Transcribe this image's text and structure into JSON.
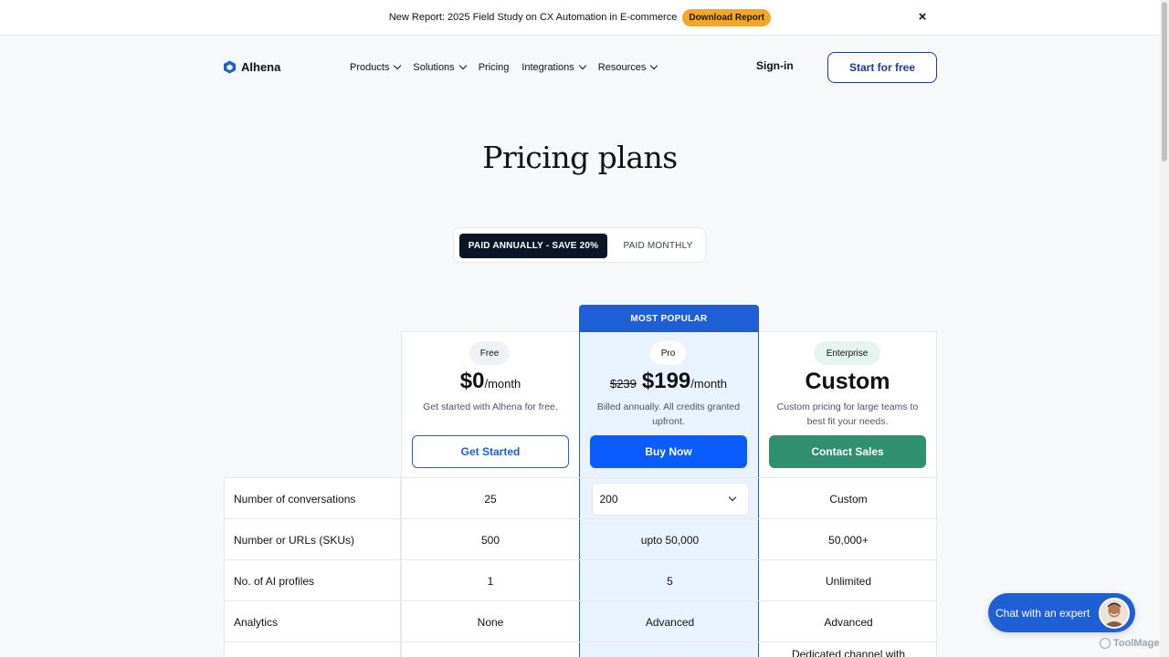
{
  "announcement": {
    "text": "New Report: 2025 Field Study on CX Automation in E-commerce",
    "button_label": "Download Report",
    "close_symbol": "×"
  },
  "header": {
    "brand": "Alhena",
    "nav": [
      {
        "label": "Products",
        "has_dropdown": true
      },
      {
        "label": "Solutions",
        "has_dropdown": true
      },
      {
        "label": "Pricing",
        "has_dropdown": false
      },
      {
        "label": "Integrations",
        "has_dropdown": true
      },
      {
        "label": "Resources",
        "has_dropdown": true
      }
    ],
    "signin_label": "Sign-in",
    "start_label": "Start for free"
  },
  "page": {
    "title": "Pricing plans"
  },
  "billing_toggle": {
    "annual_label": "PAID ANNUALLY - SAVE 20%",
    "monthly_label": "PAID MONTHLY",
    "selected": "annual"
  },
  "plans": {
    "most_popular_label": "MOST POPULAR",
    "free": {
      "badge": "Free",
      "price": "$0",
      "period": "/month",
      "description": "Get started with Alhena for free.",
      "cta": "Get Started"
    },
    "pro": {
      "badge": "Pro",
      "old_price": "$239",
      "price": "$199",
      "period": "/month",
      "description": "Billed annually. All credits granted upfront.",
      "cta": "Buy Now"
    },
    "enterprise": {
      "badge": "Enterprise",
      "price": "Custom",
      "description": "Custom pricing for large teams to best fit your needs.",
      "cta": "Contact Sales"
    }
  },
  "features": [
    {
      "label": "Number of conversations",
      "free": "25",
      "pro": "200",
      "enterprise": "Custom"
    },
    {
      "label": "Number or URLs (SKUs)",
      "free": "500",
      "pro": "upto 50,000",
      "enterprise": "50,000+"
    },
    {
      "label": "No. of AI profiles",
      "free": "1",
      "pro": "5",
      "enterprise": "Unlimited"
    },
    {
      "label": "Analytics",
      "free": "None",
      "pro": "Advanced",
      "enterprise": "Advanced"
    },
    {
      "label": "",
      "free": "",
      "pro": "",
      "enterprise": "Dedicated channel with"
    }
  ],
  "chat_widget": {
    "label": "Chat with an expert"
  },
  "watermark": "ToolMage",
  "colors": {
    "brand_blue": "#1f5fd6",
    "cta_blue": "#0a5cff",
    "enterprise_green": "#2f8f6f",
    "download_orange": "#f5a623",
    "toggle_dark": "#0b1527",
    "pro_column_bg": "#e9f2ff"
  }
}
